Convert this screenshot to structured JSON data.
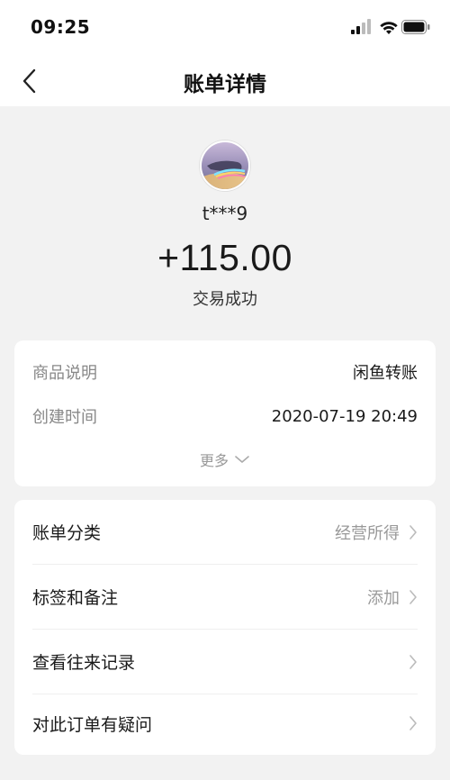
{
  "status_bar": {
    "time": "09:25"
  },
  "nav": {
    "title": "账单详情"
  },
  "profile": {
    "user_name": "t***9",
    "amount": "+115.00",
    "status": "交易成功"
  },
  "details": {
    "rows": [
      {
        "label": "商品说明",
        "value": "闲鱼转账"
      },
      {
        "label": "创建时间",
        "value": "2020-07-19 20:49"
      }
    ],
    "more_label": "更多"
  },
  "actions": [
    {
      "label": "账单分类",
      "value": "经营所得"
    },
    {
      "label": "标签和备注",
      "value": "添加"
    },
    {
      "label": "查看往来记录",
      "value": ""
    },
    {
      "label": "对此订单有疑问",
      "value": ""
    }
  ]
}
